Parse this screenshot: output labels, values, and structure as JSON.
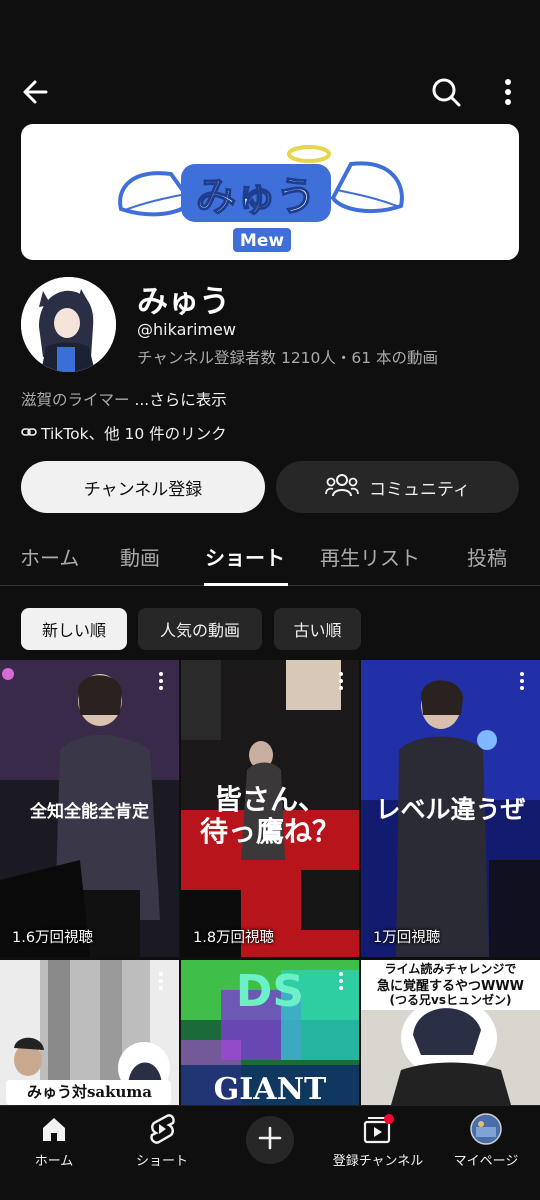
{
  "channel": {
    "banner_text": "みゅう",
    "banner_subtext": "Mew",
    "name": "みゅう",
    "handle": "@hikarimew",
    "stats": "チャンネル登録者数 1210人・61 本の動画",
    "description": "滋賀のライマー ",
    "description_more": "...さらに表示",
    "links": "TikTok、他 10 件のリンク"
  },
  "buttons": {
    "subscribe": "チャンネル登録",
    "community": "コミュニティ"
  },
  "tabs": [
    {
      "label": "ホーム"
    },
    {
      "label": "動画"
    },
    {
      "label": "ショート",
      "active": true
    },
    {
      "label": "再生リスト"
    },
    {
      "label": "投稿"
    }
  ],
  "chips": [
    {
      "label": "新しい順",
      "active": true
    },
    {
      "label": "人気の動画"
    },
    {
      "label": "古い順"
    }
  ],
  "shorts": [
    {
      "caption": "全知全能全肯定",
      "views": "1.6万回視聴"
    },
    {
      "caption_line1": "皆さん、",
      "caption_line2": "待っ鷹ね？",
      "views": "1.8万回視聴"
    },
    {
      "caption": "レベル違うぜ",
      "views": "1万回視聴"
    },
    {
      "caption": "みゅう対sakuma"
    },
    {
      "caption": "GIANT",
      "caption_top": "DS"
    },
    {
      "caption_line1": "ライム読みチャレンジで",
      "caption_line2": "急に覚醒するやつWWW",
      "caption_line3": "(つる兄vsヒュンゼン)"
    }
  ],
  "nav": [
    {
      "label": "ホーム",
      "icon": "home-icon"
    },
    {
      "label": "ショート",
      "icon": "shorts-icon"
    },
    {
      "label": "",
      "icon": "create-icon"
    },
    {
      "label": "登録チャンネル",
      "icon": "subscriptions-icon"
    },
    {
      "label": "マイページ",
      "icon": "avatar"
    }
  ],
  "colors": {
    "background": "#0f0f0f",
    "chip_bg": "#272727",
    "banner_blue": "#3f6fd8",
    "notification_red": "#ff0033"
  }
}
